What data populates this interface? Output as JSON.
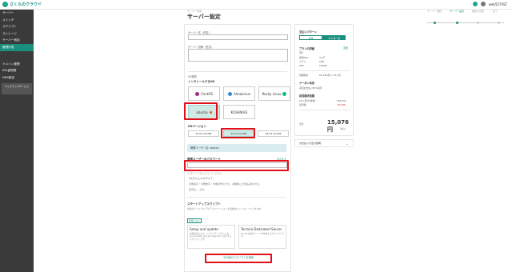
{
  "header": {
    "logo_text": "さくらのクラウド",
    "account": "web5574ST",
    "icons": [
      "help-icon",
      "bell-icon",
      "user-icon"
    ]
  },
  "sidebar": {
    "items": [
      {
        "label": "サーバー"
      },
      {
        "label": "スイッチ"
      },
      {
        "label": "スクリプト"
      },
      {
        "label": "ストレージ"
      },
      {
        "label": "サーバー追加"
      },
      {
        "label": "管理作成"
      }
    ],
    "items2": [
      {
        "label": "ドメイン管理"
      },
      {
        "label": "SSL証明書"
      },
      {
        "label": "DNS設定"
      }
    ],
    "banner": "バックアップサービス"
  },
  "page": {
    "breadcrumb": "サーバー作成",
    "title": "サーバー設定"
  },
  "steps": [
    "サーバー選択",
    "サーバー設定",
    "規約に同意",
    "完了"
  ],
  "form": {
    "server_name_label": "サーバー名（任意）",
    "server_desc_label": "サーバー説明（任意）",
    "os_section_label": "OS選択",
    "os_heading": "インストールするOS",
    "os_options": [
      {
        "name": "CentOS",
        "icon": "centos-icon",
        "color": "#9b2d7a"
      },
      {
        "name": "AlmaLinux",
        "icon": "almalinux-icon",
        "color": "#2e8bd3"
      },
      {
        "name": "Rocky Linux",
        "icon": "rocky-icon",
        "color": "#10b981"
      },
      {
        "name": "ubuntu",
        "icon": "ubuntu-icon",
        "color": "#e95420"
      },
      {
        "name": "KUSANAGI",
        "icon": "kusanagi-icon",
        "color": "#333333"
      }
    ],
    "version_heading": "OSバージョン",
    "versions": [
      "22.04 amd64",
      "20.04 amd64",
      "18.04 amd64"
    ],
    "admin_user": "管理ユーザー名: ubuntu",
    "password_label": "管理ユーザーのパスワード",
    "password_link": "表示する",
    "password_hint": "パスワードを入力してください",
    "rules": [
      "8文字以上32文字以下",
      "半角英字・半角数字・半角記号のうち、2種類以上を組み合わせる",
      "記号は -_ のみ"
    ],
    "startup_heading": "スタートアップスクリプト",
    "startup_note": "各種のソフトウェアやアプリケーションを自動的にインストールできます。",
    "startup_tag": "利用しない",
    "scripts": [
      {
        "title": "Setup and update",
        "text": "初期設定および、システムアップデートをyum update 又は apt upgrade で実行するスクリプトです。"
      },
      {
        "title": "Terraria Dedicated Server",
        "text": "Terraria専用サーバーを作成するスクリプトです。"
      }
    ],
    "more_button": "その他のスクリプトを検索"
  },
  "summary": {
    "plan_type_label": "支払いパターン",
    "tabs": [
      "月額",
      "12ヶ月一括"
    ],
    "selected_tab": 1,
    "plan_label": "プランの詳細",
    "change_link": "変更",
    "plan_name": "2G",
    "specs": [
      {
        "k": "仮想CPU",
        "v": "3コア"
      },
      {
        "k": "メモリ",
        "v": "2GB"
      },
      {
        "k": "SSD",
        "v": "100GB"
      }
    ],
    "price_label": "月額料金",
    "price_row": "¥1,536/月 × 12ヶ月",
    "coupon_heading": "クーポン利用",
    "coupon_text": "初回お支払い30%割引",
    "campaign_heading": "初回請求金額",
    "campaign_rows": [
      {
        "k": "12ヶ月分の料金",
        "v": "¥18,432"
      },
      {
        "k": "割引額",
        "v": "-¥3,356",
        "red": true
      }
    ],
    "total_label": "合計",
    "total": "15,076 円",
    "total_sub": "（税込）",
    "accordion": "お支払い方法の説明"
  }
}
